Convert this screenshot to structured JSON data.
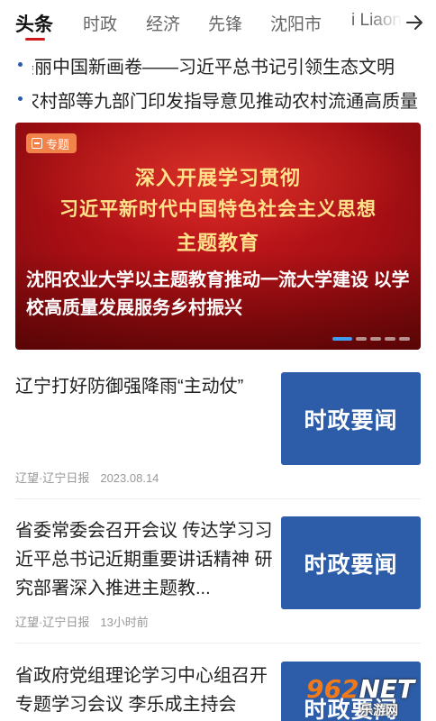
{
  "tabs": [
    "头条",
    "时政",
    "经济",
    "先锋",
    "沈阳市",
    "i Liaoning"
  ],
  "headlines": [
    "美丽中国新画卷——习近平总书记引领生态文明",
    "农业农村部等九部门印发指导意见推动农村流通高质量"
  ],
  "banner": {
    "tag": "专题",
    "theme_line1": "深入开展学习贯彻",
    "theme_line2": "习近平新时代中国特色社会主义思想",
    "theme_line3": "主题教育",
    "title": "沈阳农业大学以主题教育推动一流大学建设 以学校高质量发展服务乡村振兴",
    "slide_count": 5,
    "active_slide": 1
  },
  "news": [
    {
      "title": "辽宁打好防御强降雨“主动仗”",
      "source": "辽望·辽宁日报",
      "time": "2023.08.14",
      "thumb": "时政要闻"
    },
    {
      "title": "省委常委会召开会议 传达学习习近平总书记近期重要讲话精神 研究部署深入推进主题教...",
      "source": "辽望·辽宁日报",
      "time": "13小时前",
      "thumb": "时政要闻"
    },
    {
      "title": "省政府党组理论学习中心组召开专题学习会议 李乐成主持会",
      "source": "",
      "time": "",
      "thumb": "时政要闻"
    }
  ],
  "watermark": {
    "brand": "962",
    "net": "NET",
    "sub": "乐游网"
  },
  "colors": {
    "accent": "#d0191f",
    "thumb_blue": "#2d5ca8",
    "banner_red": "#b0121a",
    "tag_orange": "#f0824a"
  }
}
